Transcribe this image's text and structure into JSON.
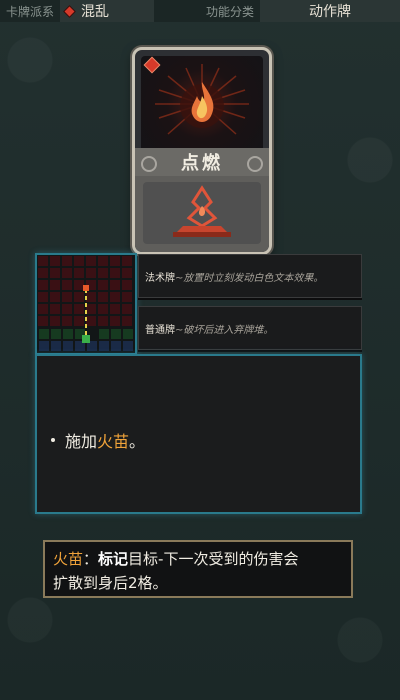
{
  "top_bar": {
    "faction_label": "卡牌派系",
    "faction_value": "混乱",
    "category_label": "功能分类",
    "category_value": "动作牌"
  },
  "card": {
    "name": "点燃",
    "frame_color": "#c9c3b5",
    "gem_color": "#d63a2a"
  },
  "tags": [
    {
      "name": "法术牌",
      "desc": "~放置时立刻发动白色文本效果。"
    },
    {
      "name": "普通牌",
      "desc": "~破坏后进入弃牌堆。"
    }
  ],
  "description": {
    "prefix": "施加",
    "keyword": "火苗",
    "suffix": "。"
  },
  "tooltip": {
    "term": "火苗",
    "colon": "：",
    "bold": "标记",
    "text_1": "目标-下一次受到的伤害会",
    "text_2": "扩散到身后2格。"
  },
  "colors": {
    "highlight": "#f0a33a",
    "panel_border": "#2a7a8c",
    "tooltip_border": "#8a7a5a"
  }
}
